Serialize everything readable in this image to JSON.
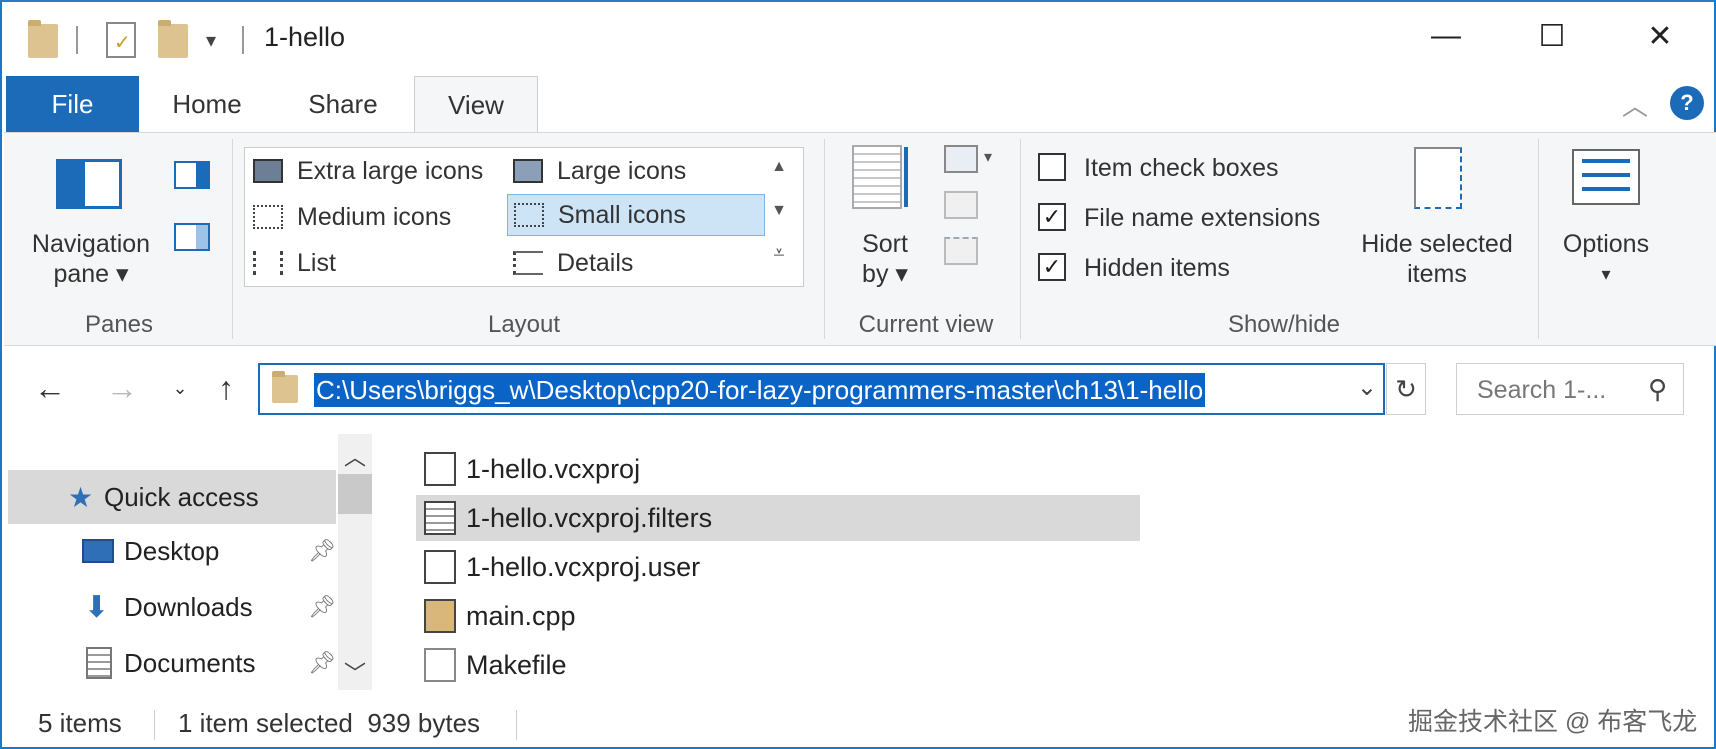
{
  "window": {
    "title": "1-hello",
    "controls": {
      "minimize": "—",
      "maximize": "☐",
      "close": "✕"
    }
  },
  "ribbon": {
    "tabs": [
      "File",
      "Home",
      "Share",
      "View"
    ],
    "active_tab": "View",
    "collapse_glyph": "︿",
    "help_glyph": "?",
    "panes": {
      "navigation_pane_line1": "Navigation",
      "navigation_pane_line2": "pane ▾",
      "group_label": "Panes"
    },
    "layout": {
      "items": [
        "Extra large icons",
        "Large icons",
        "Medium icons",
        "Small icons",
        "List",
        "Details"
      ],
      "selected": "Small icons",
      "group_label": "Layout"
    },
    "current_view": {
      "sort_line1": "Sort",
      "sort_line2": "by ▾",
      "group_label": "Current view"
    },
    "show_hide": {
      "checkboxes": [
        {
          "label": "Item check boxes",
          "checked": false
        },
        {
          "label": "File name extensions",
          "checked": true
        },
        {
          "label": "Hidden items",
          "checked": true
        }
      ],
      "hide_selected_line1": "Hide selected",
      "hide_selected_line2": "items",
      "group_label": "Show/hide"
    },
    "options": {
      "label": "Options",
      "arrow": "▾"
    }
  },
  "address_bar": {
    "path": "C:\\Users\\briggs_w\\Desktop\\cpp20-for-lazy-programmers-master\\ch13\\1-hello",
    "search_placeholder": "Search 1-..."
  },
  "nav_pane": {
    "items": [
      {
        "label": "Quick access",
        "icon": "star-icon",
        "pinned": false
      },
      {
        "label": "Desktop",
        "icon": "desktop-icon",
        "pinned": true
      },
      {
        "label": "Downloads",
        "icon": "download-icon",
        "pinned": true
      },
      {
        "label": "Documents",
        "icon": "documents-icon",
        "pinned": true
      }
    ]
  },
  "files": [
    {
      "name": "1-hello.vcxproj",
      "icon": "vcxproj-icon"
    },
    {
      "name": "1-hello.vcxproj.filters",
      "icon": "filters-icon",
      "selected": true
    },
    {
      "name": "1-hello.vcxproj.user",
      "icon": "vs-user-icon"
    },
    {
      "name": "main.cpp",
      "icon": "cpp-file-icon"
    },
    {
      "name": "Makefile",
      "icon": "blank-file-icon"
    }
  ],
  "status_bar": {
    "item_count": "5 items",
    "selection": "1 item selected  939 bytes"
  },
  "watermark": "掘金技术社区 @ 布客飞龙",
  "colors": {
    "accent": "#1c6bb9",
    "selection": "#d9d9d9",
    "path_highlight": "#0a64c8"
  }
}
